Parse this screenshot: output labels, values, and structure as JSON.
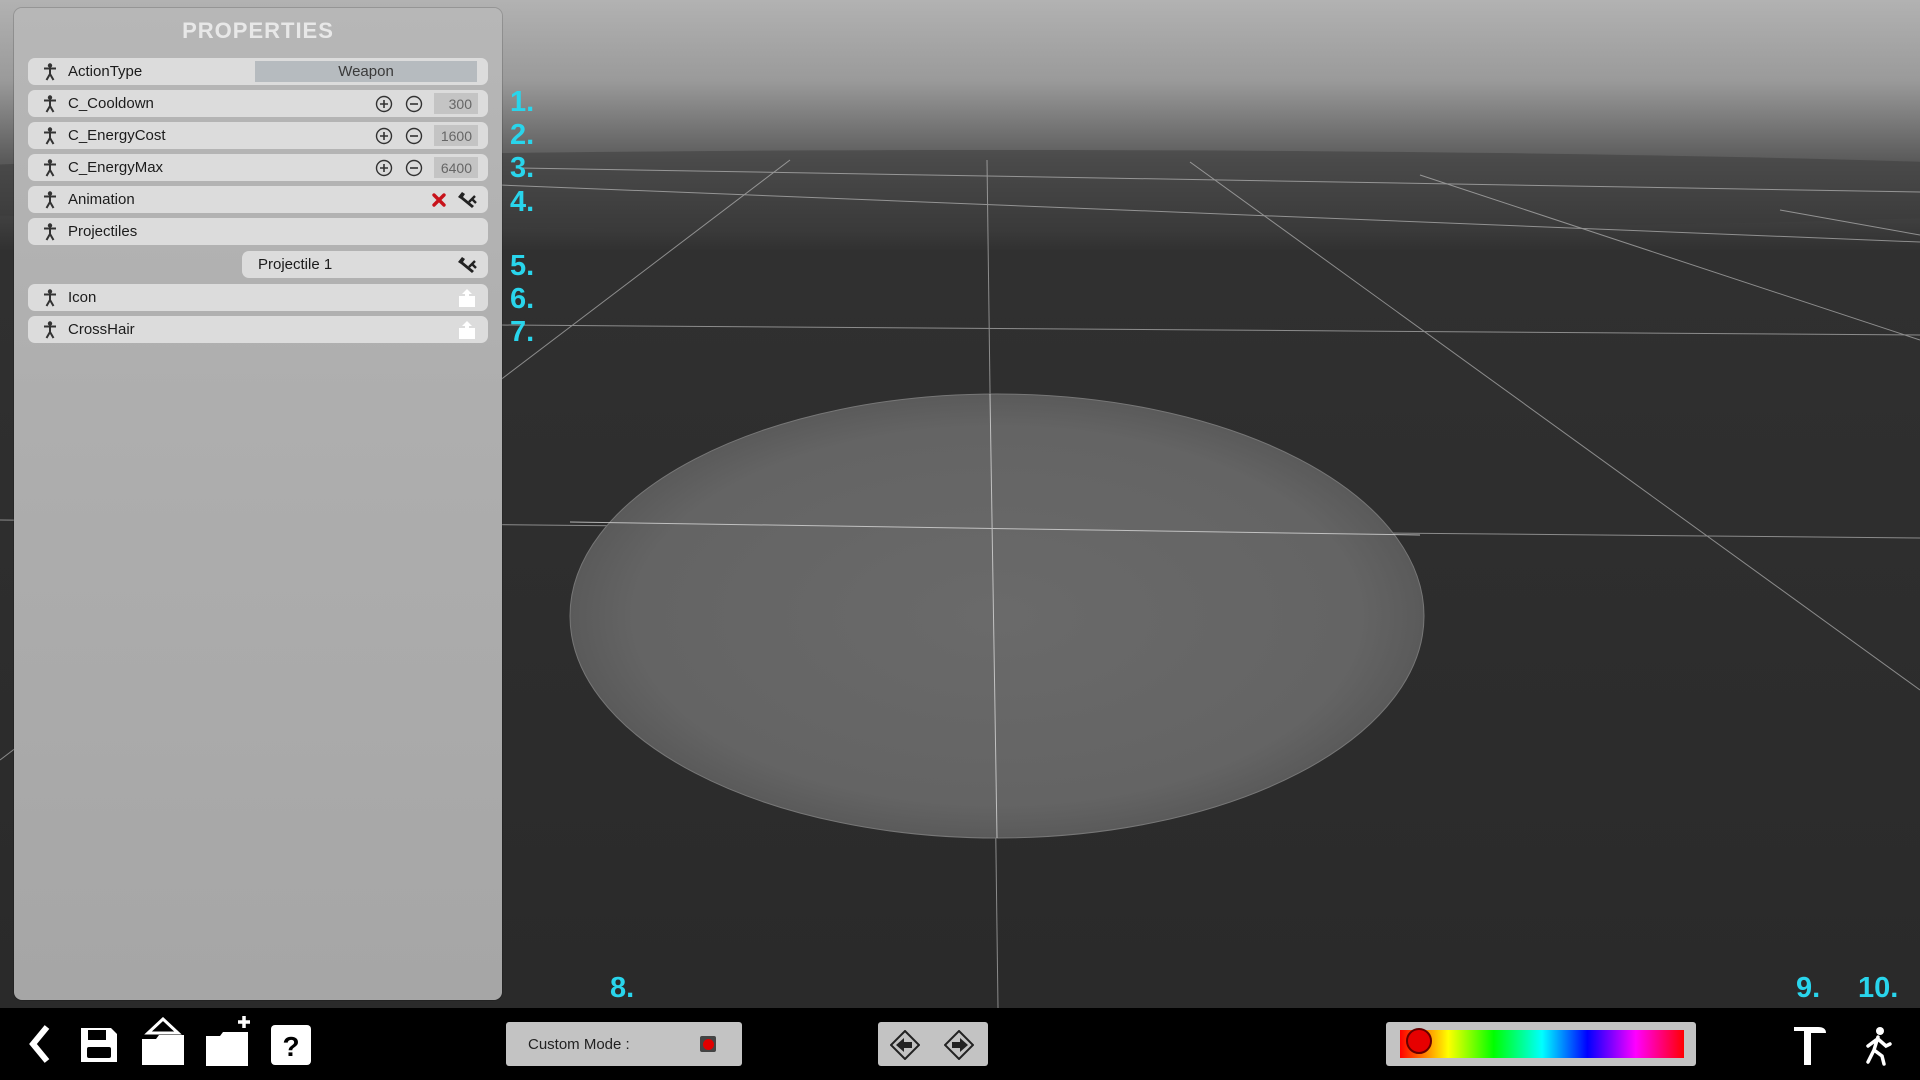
{
  "panel": {
    "title": "PROPERTIES",
    "rows": [
      {
        "label": "ActionType",
        "value": "Weapon"
      },
      {
        "label": "C_Cooldown",
        "value": "300"
      },
      {
        "label": "C_EnergyCost",
        "value": "1600"
      },
      {
        "label": "C_EnergyMax",
        "value": "6400"
      },
      {
        "label": "Animation"
      },
      {
        "label": "Projectiles"
      },
      {
        "label": "Icon"
      },
      {
        "label": "CrossHair"
      }
    ],
    "sub_rows": [
      {
        "label": "Projectile 1"
      }
    ]
  },
  "annotations": [
    "1.",
    "2.",
    "3.",
    "4.",
    "5.",
    "6.",
    "7.",
    "8.",
    "9.",
    "10."
  ],
  "bottom_bar": {
    "custom_mode_label": "Custom Mode :",
    "record_color": "#e00000",
    "accent_color": "#29d5ec",
    "icons": [
      "back-icon",
      "save-icon",
      "export-icon",
      "new-folder-icon",
      "help-icon",
      "left-arrow-icon",
      "right-arrow-icon",
      "hammer-icon",
      "walk-icon"
    ]
  }
}
